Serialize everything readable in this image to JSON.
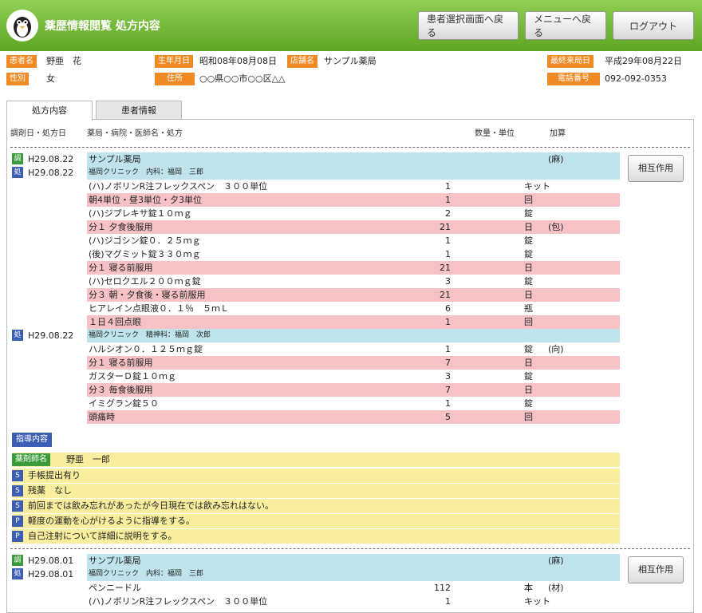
{
  "header": {
    "title": "薬歴情報閲覧 処方内容",
    "buttons": [
      "患者選択画面へ戻る",
      "メニューへ戻る",
      "ログアウト"
    ]
  },
  "patient": {
    "name_label": "患者名",
    "name": "野亜　花",
    "sex_label": "性別",
    "sex": "女",
    "dob_label": "生年月日",
    "dob": "昭和08年08月08日",
    "store_label": "店舗名",
    "store": "サンプル薬局",
    "addr_label": "住所",
    "addr": "○○県○○市○○区△△",
    "last_label": "最終来局日",
    "last": "平成29年08月22日",
    "tel_label": "電話番号",
    "tel": "092-092-0353"
  },
  "tabs": [
    "処方内容",
    "患者情報"
  ],
  "columns": {
    "date": "調剤日・処方日",
    "desc": "薬局・病院・医師名・処方",
    "qty": "数量・単位",
    "add": "加算"
  },
  "interaction_button": "相互作用",
  "block1": {
    "pharmacy": {
      "badge": "調",
      "date": "H29.08.22",
      "name": "サンプル薬局",
      "add": "(麻)"
    },
    "rx": [
      {
        "badge": "処",
        "date": "H29.08.22",
        "clinic": "福岡クリニック　内科：福岡　三郎",
        "items": [
          {
            "t": "(ハ)ノボリンR注フレックスペン　３００単位",
            "q": "1",
            "u": "キット",
            "c": "",
            "a": ""
          },
          {
            "t": "朝4単位・昼3単位・夕3単位",
            "q": "1",
            "u": "回",
            "c": "pink",
            "a": ""
          },
          {
            "t": "(ハ)ジプレキサ錠１０ｍｇ",
            "q": "2",
            "u": "錠",
            "c": "",
            "a": ""
          },
          {
            "t": "分１ 夕食後服用",
            "q": "21",
            "u": "日",
            "c": "pink",
            "a": "(包)"
          },
          {
            "t": "(ハ)ジゴシン錠０．２５ｍｇ",
            "q": "1",
            "u": "錠",
            "c": "",
            "a": ""
          },
          {
            "t": "(後)マグミット錠３３０ｍｇ",
            "q": "1",
            "u": "錠",
            "c": "",
            "a": ""
          },
          {
            "t": "分１ 寝る前服用",
            "q": "21",
            "u": "日",
            "c": "pink",
            "a": ""
          },
          {
            "t": "(ハ)セロクエル２００ｍｇ錠",
            "q": "3",
            "u": "錠",
            "c": "",
            "a": ""
          },
          {
            "t": "分３ 朝・夕食後・寝る前服用",
            "q": "21",
            "u": "日",
            "c": "pink",
            "a": ""
          },
          {
            "t": "ヒアレイン点眼液０．１％　５ｍＬ",
            "q": "6",
            "u": "瓶",
            "c": "",
            "a": ""
          },
          {
            "t": "１日４回点眼",
            "q": "1",
            "u": "回",
            "c": "pink",
            "a": ""
          }
        ]
      },
      {
        "badge": "処",
        "date": "H29.08.22",
        "clinic": "福岡クリニック　精神科：福岡　次郎",
        "items": [
          {
            "t": "ハルシオン０．１２５ｍｇ錠",
            "q": "1",
            "u": "錠",
            "c": "",
            "a": "(向)"
          },
          {
            "t": "分１ 寝る前服用",
            "q": "7",
            "u": "日",
            "c": "pink",
            "a": ""
          },
          {
            "t": "ガスターＤ錠１０ｍｇ",
            "q": "3",
            "u": "錠",
            "c": "",
            "a": ""
          },
          {
            "t": "分３ 毎食後服用",
            "q": "7",
            "u": "日",
            "c": "pink",
            "a": ""
          },
          {
            "t": "イミグラン錠５０",
            "q": "1",
            "u": "錠",
            "c": "",
            "a": ""
          },
          {
            "t": "頭痛時",
            "q": "5",
            "u": "回",
            "c": "pink",
            "a": ""
          }
        ]
      }
    ]
  },
  "guidance": {
    "title": "指導内容",
    "pharmacist_label": "薬剤師名",
    "pharmacist": "野亜　一郎",
    "lines": [
      {
        "b": "S",
        "t": "手帳提出有り"
      },
      {
        "b": "S",
        "t": "残薬　なし"
      },
      {
        "b": "S",
        "t": "前回までは飲み忘れがあったが今日現在では飲み忘れはない。"
      },
      {
        "b": "P",
        "t": "軽度の運動を心がけるように指導をする。"
      },
      {
        "b": "P",
        "t": "自己注射について詳細に説明をする。"
      }
    ]
  },
  "block2": {
    "pharmacy": {
      "badge": "調",
      "date": "H29.08.01",
      "name": "サンプル薬局",
      "add": "(麻)"
    },
    "rx": {
      "badge": "処",
      "date": "H29.08.01",
      "clinic": "福岡クリニック　内科：福岡　三郎",
      "items": [
        {
          "t": "ペンニードル",
          "q": "112",
          "u": "本",
          "c": "",
          "a": "(材)"
        },
        {
          "t": "(ハ)ノボリンR注フレックスペン　３００単位",
          "q": "1",
          "u": "キット",
          "c": "",
          "a": ""
        }
      ]
    }
  }
}
